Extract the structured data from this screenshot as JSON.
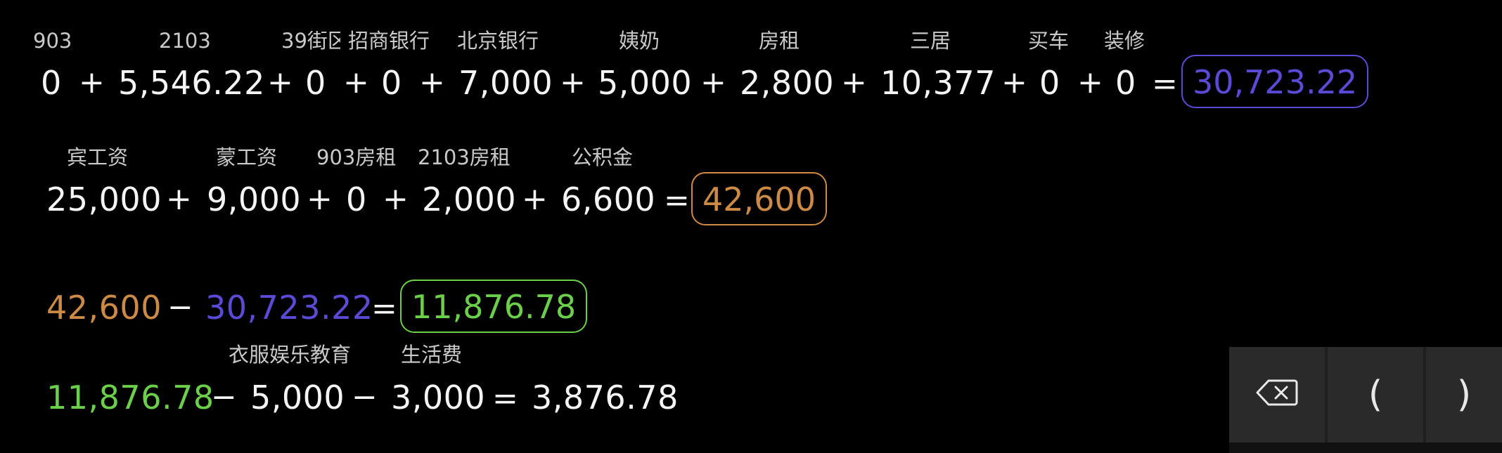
{
  "row1": {
    "labels": [
      "903",
      "2103",
      "39街区",
      "招商银行",
      "北京银行",
      "姨奶",
      "房租",
      "三居",
      "买车",
      "装修"
    ],
    "values": [
      "0",
      "5,546.22",
      "0",
      "0",
      "7,000",
      "5,000",
      "2,800",
      "10,377",
      "0",
      "0"
    ],
    "result": "30,723.22"
  },
  "row2": {
    "labels": [
      "宾工资",
      "蒙工资",
      "903房租",
      "2103房租",
      "公积金"
    ],
    "values": [
      "25,000",
      "9,000",
      "0",
      "2,000",
      "6,600"
    ],
    "result": "42,600"
  },
  "row3": {
    "a": "42,600",
    "b": "30,723.22",
    "result": "11,876.78"
  },
  "row4": {
    "labels": [
      "衣服娱乐教育",
      "生活费"
    ],
    "a": "11,876.78",
    "b": "5,000",
    "c": "3,000",
    "result": "3,876.78"
  },
  "operators": {
    "plus": "+",
    "minus": "−",
    "equals": "="
  },
  "keypad": {
    "backspace_icon": "backspace-icon",
    "open_paren": "(",
    "close_paren": ")"
  },
  "colors": {
    "expense_total": "#5a4ad6",
    "income_total": "#cc8a45",
    "balance": "#6ccf4a",
    "background": "#000000"
  }
}
